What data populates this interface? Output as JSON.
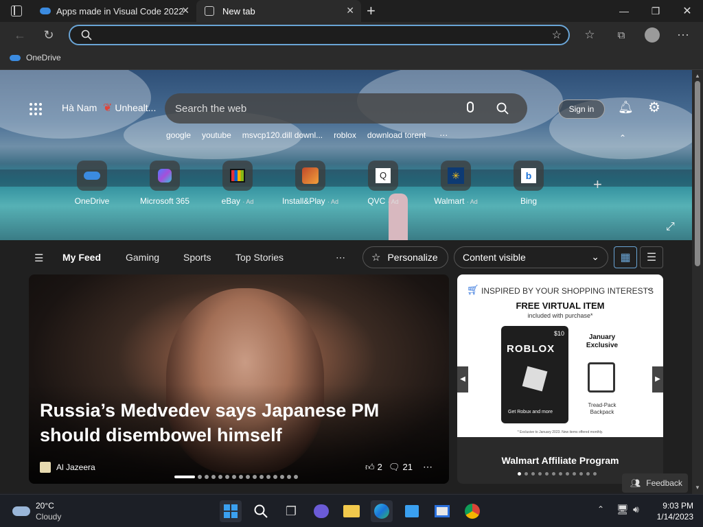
{
  "tabs": [
    {
      "label": "Apps made in Visual Code 2022",
      "active": false
    },
    {
      "label": "New tab",
      "active": true
    }
  ],
  "favorites": {
    "onedrive": "OneDrive"
  },
  "hero": {
    "location": "Hà Nam",
    "health": "Unhealt...",
    "search_placeholder": "Search the web",
    "sign_in": "Sign in",
    "quick_links": [
      "google",
      "youtube",
      "msvcp120.dill downl...",
      "roblox",
      "download torent"
    ],
    "shortcuts": [
      {
        "label": "OneDrive",
        "ad": ""
      },
      {
        "label": "Microsoft 365",
        "ad": ""
      },
      {
        "label": "eBay",
        "ad": "· Ad"
      },
      {
        "label": "Install&Play",
        "ad": "· Ad"
      },
      {
        "label": "QVC",
        "ad": "· Ad"
      },
      {
        "label": "Walmart",
        "ad": "· Ad"
      },
      {
        "label": "Bing",
        "ad": ""
      }
    ]
  },
  "feed_nav": {
    "items": [
      "My Feed",
      "Gaming",
      "Sports",
      "Top Stories"
    ],
    "personalize": "Personalize",
    "content_visible": "Content visible"
  },
  "main_story": {
    "headline": "Russia’s Medvedev says Japanese PM should disembowel himself",
    "source": "Al Jazeera",
    "likes": "2",
    "comments": "21"
  },
  "ad_card": {
    "header": "INSPIRED BY YOUR SHOPPING INTERESTS",
    "title": "FREE VIRTUAL ITEM",
    "subtitle": "included with purchase*",
    "price": "$10",
    "brand": "ROBLOX",
    "card_caption": "Get Robux and more",
    "exclusive": "January Exclusive",
    "item": "Tread-Pack Backpack",
    "fineprint": "* Exclusive to January 2023. New items offered monthly.",
    "footer": "Walmart Affiliate Program"
  },
  "feedback": "Feedback",
  "taskbar": {
    "temp": "20°C",
    "condition": "Cloudy",
    "time": "9:03 PM",
    "date": "1/14/2023"
  },
  "colors": {
    "accent": "#6aa5d6",
    "background": "#202020"
  }
}
